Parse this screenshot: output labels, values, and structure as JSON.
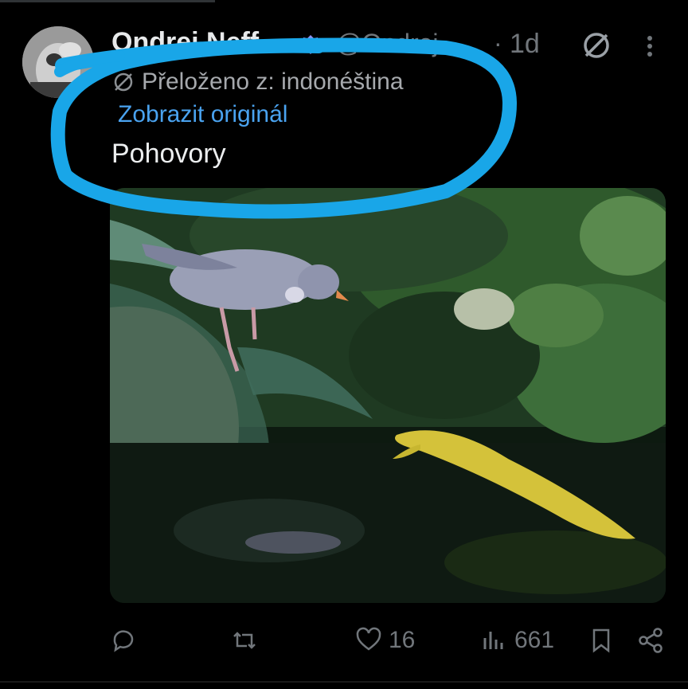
{
  "tweet": {
    "author_name": "Ondrej Neff",
    "handle": "@Ondrej",
    "separator": "·",
    "time": "1d",
    "translated_label": "Přeloženo z: indonéština",
    "show_original_label": "Zobrazit originál",
    "text": "Pohovory"
  },
  "actions": {
    "likes": "16",
    "views": "661"
  },
  "icons": {
    "verified": "verified-badge-icon",
    "grok": "grok-icon",
    "more": "more-vertical-icon",
    "reply": "reply-icon",
    "retweet": "retweet-icon",
    "like": "heart-icon",
    "views": "views-chart-icon",
    "bookmark": "bookmark-icon",
    "share": "share-icon"
  },
  "colors": {
    "background": "#000000",
    "link": "#4aa3f0",
    "muted": "#71767b",
    "annotation_stroke": "#19a6e8",
    "verified": "#8f91f0"
  }
}
